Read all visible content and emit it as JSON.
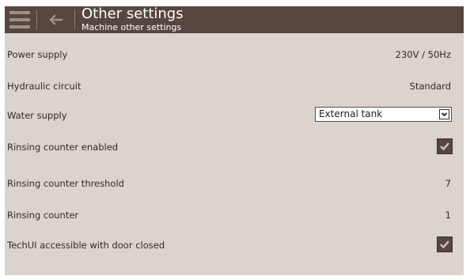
{
  "header": {
    "title": "Other settings",
    "subtitle": "Machine other settings"
  },
  "settings": {
    "power_supply": {
      "label": "Power supply",
      "value": "230V / 50Hz"
    },
    "hydraulic_circuit": {
      "label": "Hydraulic circuit",
      "value": "Standard"
    },
    "water_supply": {
      "label": "Water supply",
      "selected": "External tank"
    },
    "rinsing_counter_enabled": {
      "label": "Rinsing counter enabled",
      "checked": true
    },
    "rinsing_counter_threshold": {
      "label": "Rinsing counter threshold",
      "value": "7"
    },
    "rinsing_counter": {
      "label": "Rinsing counter",
      "value": "1"
    },
    "techui_door_closed": {
      "label": "TechUI accessible with door closed",
      "checked": true
    }
  },
  "icons": {
    "menu": "hamburger-menu-icon",
    "back": "back-arrow-icon",
    "dropdown": "chevron-down-icon",
    "check": "checkmark-icon"
  },
  "colors": {
    "header_bg": "#574640",
    "screen_bg": "#dbd3ce",
    "accent": "#574640"
  }
}
